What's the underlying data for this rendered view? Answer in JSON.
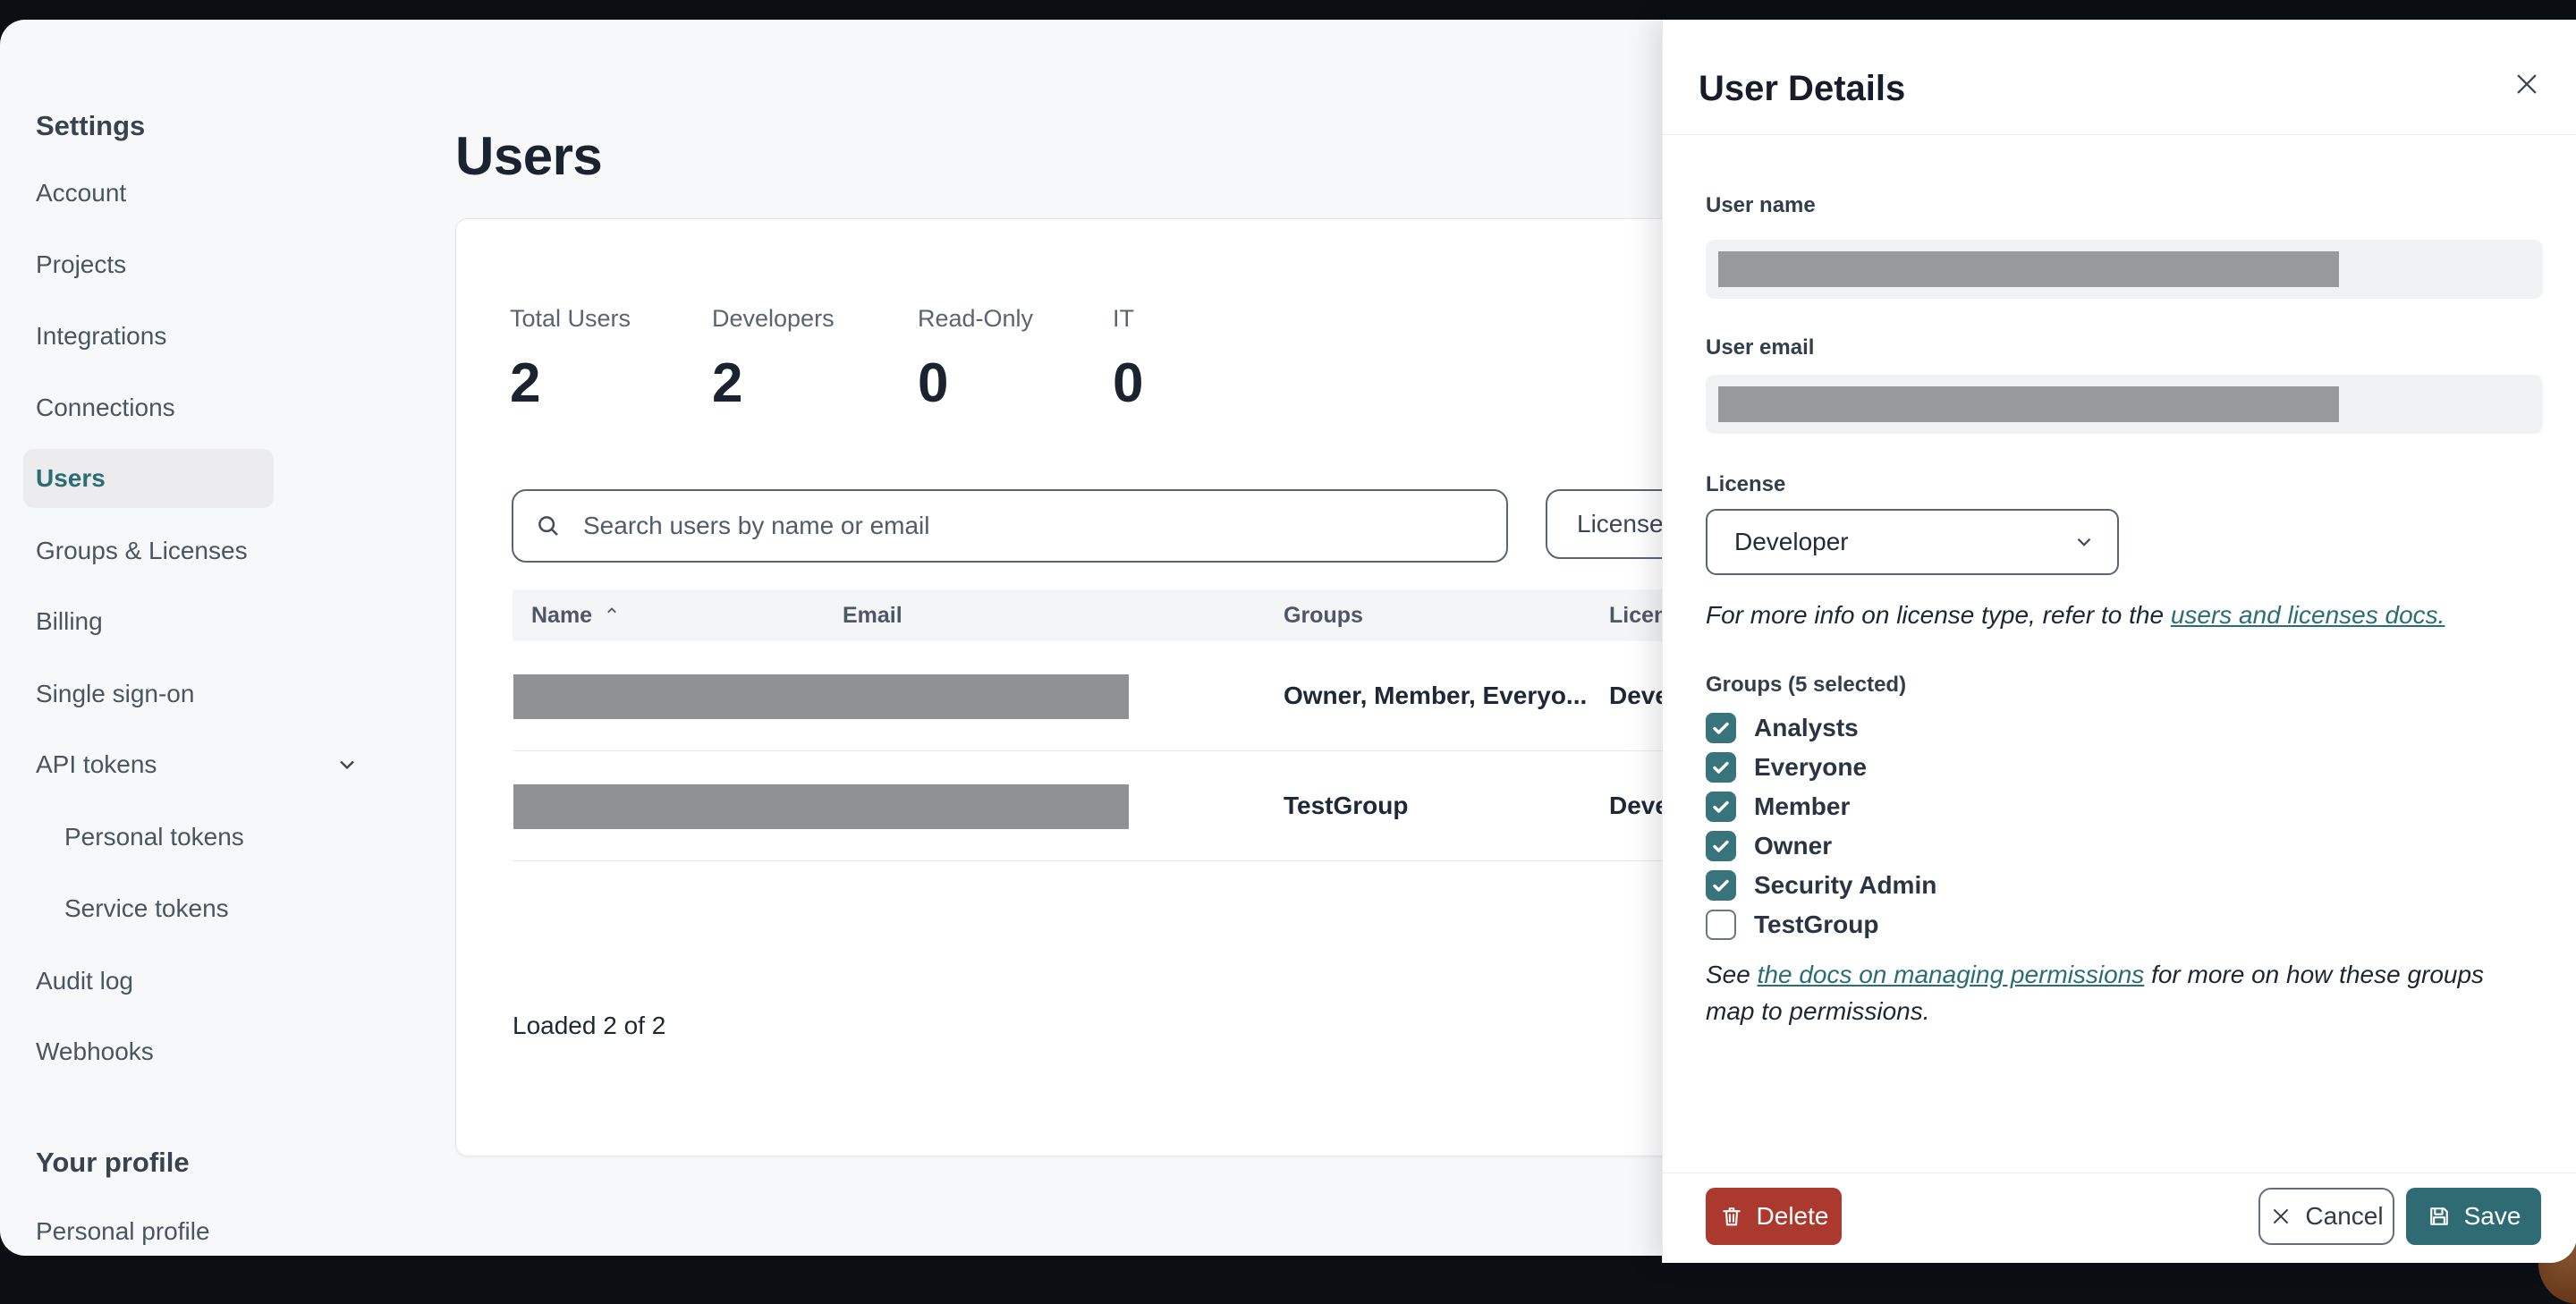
{
  "sidebar": {
    "section_title": "Settings",
    "items": [
      {
        "label": "Account"
      },
      {
        "label": "Projects"
      },
      {
        "label": "Integrations"
      },
      {
        "label": "Connections"
      },
      {
        "label": "Users",
        "active": true
      },
      {
        "label": "Groups & Licenses"
      },
      {
        "label": "Billing"
      },
      {
        "label": "Single sign-on"
      },
      {
        "label": "API tokens",
        "expandable": true
      },
      {
        "label": "Personal tokens",
        "child": true
      },
      {
        "label": "Service tokens",
        "child": true
      },
      {
        "label": "Audit log"
      },
      {
        "label": "Webhooks"
      }
    ],
    "profile_section_title": "Your profile",
    "profile_items": [
      {
        "label": "Personal profile"
      }
    ]
  },
  "main": {
    "page_title": "Users",
    "stats": [
      {
        "label": "Total Users",
        "value": "2"
      },
      {
        "label": "Developers",
        "value": "2"
      },
      {
        "label": "Read-Only",
        "value": "0"
      },
      {
        "label": "IT",
        "value": "0"
      }
    ],
    "search": {
      "placeholder": "Search users by name or email"
    },
    "license_filter_label": "License",
    "table": {
      "columns": {
        "name": "Name",
        "email": "Email",
        "groups": "Groups",
        "license": "License"
      },
      "rows": [
        {
          "name_email_redacted": true,
          "groups": "Owner, Member, Everyo...",
          "license": "Developer"
        },
        {
          "name_email_redacted": true,
          "groups": "TestGroup",
          "license": "Developer"
        }
      ],
      "status": "Loaded 2 of 2"
    }
  },
  "panel": {
    "title": "User Details",
    "user_name_label": "User name",
    "user_email_label": "User email",
    "license_label": "License",
    "license_value": "Developer",
    "license_note_prefix": "For more info on license type, refer to the ",
    "license_note_link": "users and licenses docs.",
    "groups_label": "Groups (5 selected)",
    "groups": [
      {
        "label": "Analysts",
        "checked": true
      },
      {
        "label": "Everyone",
        "checked": true
      },
      {
        "label": "Member",
        "checked": true
      },
      {
        "label": "Owner",
        "checked": true
      },
      {
        "label": "Security Admin",
        "checked": true
      },
      {
        "label": "TestGroup",
        "checked": false
      }
    ],
    "perm_note_prefix": "See ",
    "perm_note_link": "the docs on managing permissions",
    "perm_note_suffix": " for more on how these groups map to permissions.",
    "buttons": {
      "delete": "Delete",
      "cancel": "Cancel",
      "save": "Save"
    }
  },
  "colors": {
    "frame_dark": "#0b0f13",
    "page_bg": "#f7f8f9",
    "accent_teal": "#2a6e75",
    "checkbox_teal": "#37747c",
    "save_teal": "#2f6b72",
    "delete_red": "#ab392e",
    "redaction_gray": "#8f9193",
    "text_dark": "#1b2330",
    "text_gray": "#4a5562"
  }
}
